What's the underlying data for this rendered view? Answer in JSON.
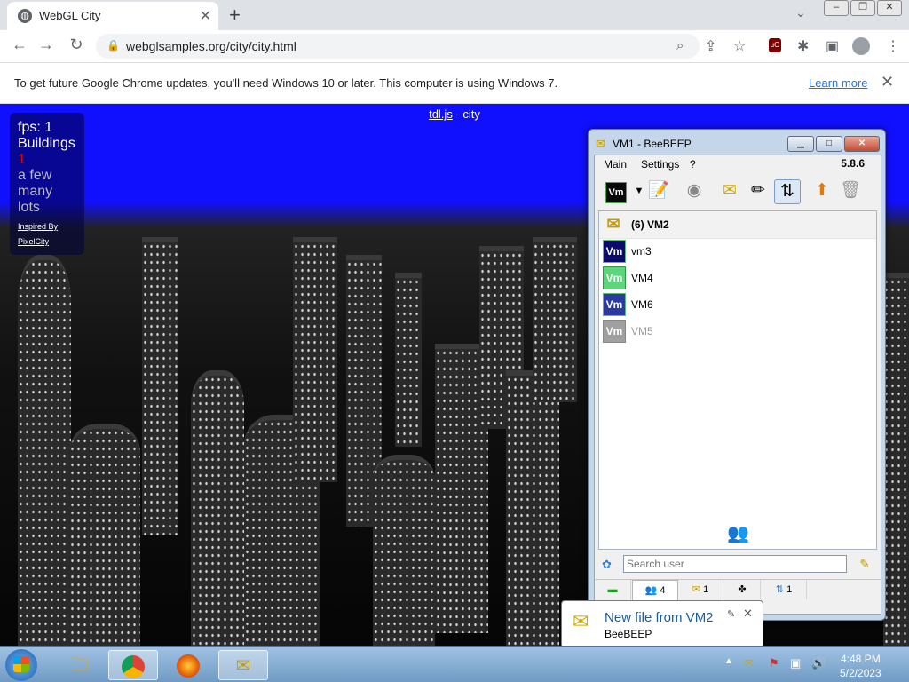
{
  "browser": {
    "tab_title": "WebGL City",
    "url": "webglsamples.org/city/city.html",
    "infobar": {
      "message": "To get future Google Chrome updates, you'll need Windows 10 or later. This computer is using Windows 7.",
      "learn_more": "Learn more"
    }
  },
  "page": {
    "title_link": "tdl.js",
    "title_rest": " - city",
    "stats": {
      "fps": "fps: 1",
      "buildings_label": "Buildings",
      "buildings_value": "1",
      "options": [
        "a few",
        "many",
        "lots"
      ],
      "inspired_by": "Inspired By",
      "pixelcity": "PixelCity"
    }
  },
  "beebeep": {
    "window_title": "VM1 - BeeBEEP",
    "menu": [
      "Main",
      "Settings",
      "?"
    ],
    "version": "5.8.6",
    "users": [
      {
        "name": "(6) VM2",
        "icon": "envelope-group-icon",
        "color": "#e8c24a",
        "selected": true,
        "online": true
      },
      {
        "name": "vm3",
        "icon": "Vm",
        "color": "#0b0b6a",
        "selected": false,
        "online": true
      },
      {
        "name": "VM4",
        "icon": "Vm",
        "color": "#5bd67a",
        "selected": false,
        "online": true
      },
      {
        "name": "VM6",
        "icon": "Vm",
        "color": "#2a3aa0",
        "selected": false,
        "online": true
      },
      {
        "name": "VM5",
        "icon": "Vm",
        "color": "#a0a0a0",
        "selected": false,
        "online": false
      }
    ],
    "search_placeholder": "Search user",
    "tabs": [
      {
        "icon": "screen-icon",
        "count": ""
      },
      {
        "icon": "users-icon",
        "count": "4"
      },
      {
        "icon": "chats-icon",
        "count": "1"
      },
      {
        "icon": "groups-icon",
        "count": ""
      },
      {
        "icon": "files-icon",
        "count": "1"
      }
    ]
  },
  "notification": {
    "title": "New file from VM2",
    "app": "BeeBEEP"
  },
  "taskbar": {
    "time": "4:48 PM",
    "date": "5/2/2023"
  }
}
